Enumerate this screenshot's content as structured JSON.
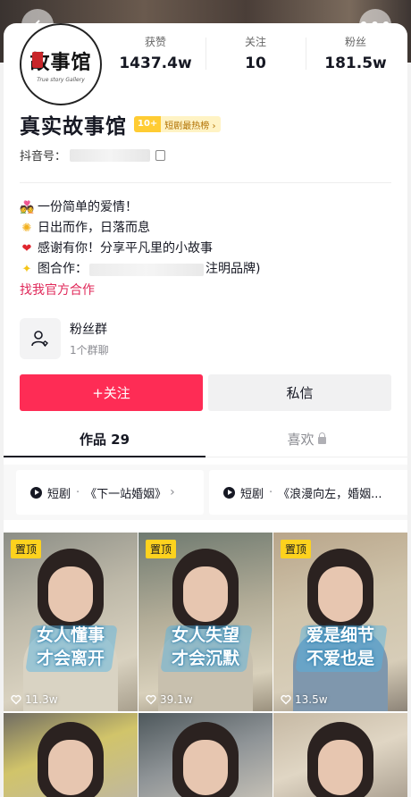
{
  "profile": {
    "avatar_title": "故事馆",
    "avatar_subtitle": "True story Gallery",
    "nickname": "真实故事馆",
    "badge_rank": "10+",
    "badge_label": "短剧最热榜 ›",
    "id_label": "抖音号：",
    "stats": [
      {
        "label": "获赞",
        "value": "1437.4w"
      },
      {
        "label": "关注",
        "value": "10"
      },
      {
        "label": "粉丝",
        "value": "181.5w"
      }
    ]
  },
  "bio": {
    "line1": "一份简单的爱情！",
    "line2": "日出而作，日落而息",
    "line3": "感谢有你！分享平凡里的小故事",
    "line4_prefix": "图合作：",
    "line4_suffix": "注明品牌)",
    "link": "找我官方合作"
  },
  "fan_group": {
    "title": "粉丝群",
    "subtitle": "1个群聊"
  },
  "buttons": {
    "follow": "+关注",
    "message": "私信"
  },
  "tabs": {
    "works": "作品 29",
    "likes": "喜欢"
  },
  "playlists": [
    {
      "tag": "短剧",
      "name": "《下一站婚姻》"
    },
    {
      "tag": "短剧",
      "name": "《浪漫向左，婚姻..."
    }
  ],
  "videos": [
    {
      "pinned": "置顶",
      "caption1": "女人懂事",
      "caption2": "才会离开",
      "likes": "11.3w"
    },
    {
      "pinned": "置顶",
      "caption1": "女人失望",
      "caption2": "才会沉默",
      "likes": "39.1w"
    },
    {
      "pinned": "置顶",
      "caption1": "爱是细节",
      "caption2": "不爱也是",
      "likes": "13.5w"
    }
  ],
  "colors": {
    "accent": "#fe2c55",
    "link": "#e0295a",
    "pin": "#fdd21e"
  }
}
